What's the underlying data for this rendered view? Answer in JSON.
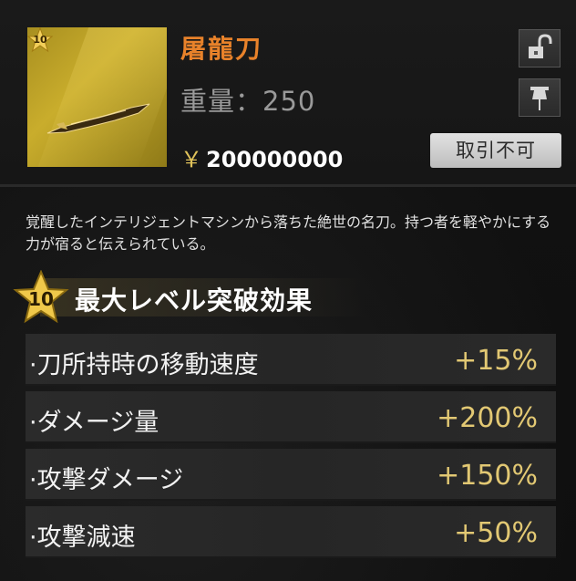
{
  "item": {
    "level_badge": "10",
    "name": "屠龍刀",
    "weight_text": "重量：250",
    "price_symbol": "￥",
    "price_value": "200000000",
    "trade_label": "取引不可",
    "description": "覚醒したインテリジェントマシンから落ちた絶世の名刀。持つ者を軽やかにする力が宿ると伝えられている。"
  },
  "section": {
    "star_level": "10",
    "title": "最大レベル突破効果"
  },
  "effects": [
    {
      "label": "·刀所持時の移動速度",
      "value": "+15%"
    },
    {
      "label": "·ダメージ量",
      "value": "+200%"
    },
    {
      "label": "·攻撃ダメージ",
      "value": "+150%"
    },
    {
      "label": "·攻撃減速",
      "value": "+50%"
    }
  ],
  "icons": {
    "lock": "unlocked-padlock-icon",
    "pin": "pin-icon",
    "star": "star-icon"
  },
  "colors": {
    "name": "#e8822a",
    "value": "#e2c873",
    "icon_bg": "#c9ad2c"
  }
}
